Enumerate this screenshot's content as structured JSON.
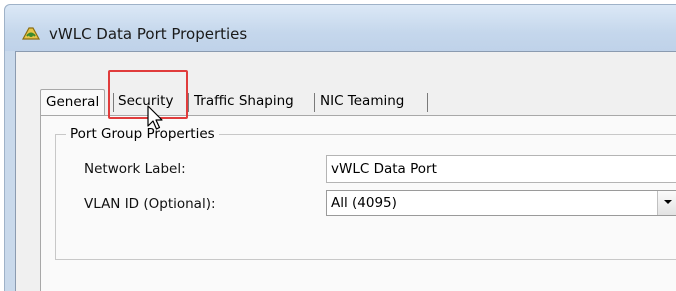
{
  "window": {
    "title": "vWLC Data Port Properties",
    "icon": "app-icon"
  },
  "tabs": [
    {
      "label": "General",
      "active": true
    },
    {
      "label": "Security",
      "active": false,
      "highlighted": true
    },
    {
      "label": "Traffic Shaping",
      "active": false
    },
    {
      "label": "NIC Teaming",
      "active": false
    }
  ],
  "port_group": {
    "legend": "Port Group Properties",
    "network_label": {
      "label": "Network Label:",
      "value": "vWLC Data Port"
    },
    "vlan_id": {
      "label": "VLAN ID (Optional):",
      "value": "All (4095)"
    }
  },
  "colors": {
    "highlight": "#e03c3c",
    "titlebar": "#c5d7ec"
  }
}
